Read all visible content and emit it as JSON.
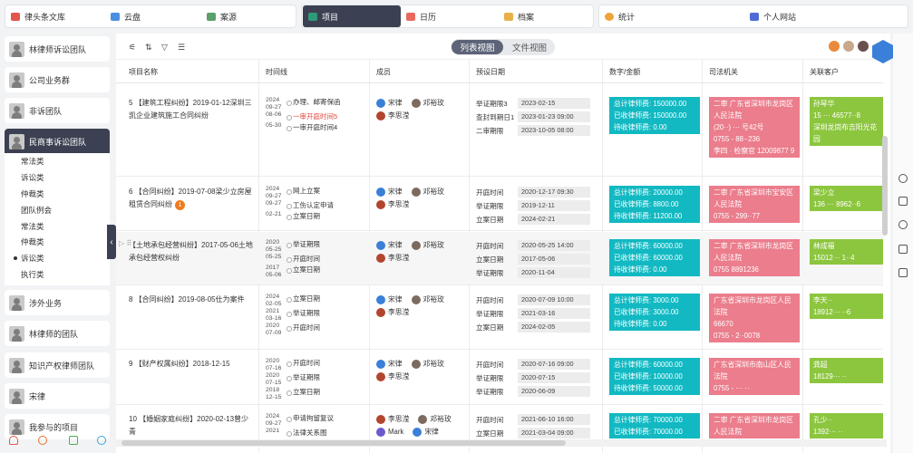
{
  "topnav": {
    "items": [
      {
        "label": "律头条文库",
        "color": "#e4554f"
      },
      {
        "label": "云盘",
        "color": "#4a90e2"
      },
      {
        "label": "案源",
        "color": "#5aa06a"
      },
      {
        "label": "项目",
        "color": "#2f9a7a"
      },
      {
        "label": "日历",
        "color": "#e86a5f"
      },
      {
        "label": "档案",
        "color": "#e8b04a"
      },
      {
        "label": "统计",
        "color": "#f0a33a"
      },
      {
        "label": "个人网站",
        "color": "#4c6bd6"
      }
    ]
  },
  "sidebar": {
    "teams": [
      "林律师诉讼团队",
      "公司业务群",
      "非诉团队",
      "民商事诉讼团队",
      "涉外业务",
      "林律师的团队",
      "知识产权律师团队",
      "宋律",
      "我参与的项目"
    ],
    "subitems": [
      "常法类",
      "诉讼类",
      "仲裁类",
      "团队例会",
      "常法类",
      "仲裁类",
      "诉讼类",
      "执行类"
    ],
    "collapse_icon": "‹"
  },
  "toolbar": {
    "view_list": "列表视图",
    "view_doc": "文件视图"
  },
  "columns": {
    "name": "项目名称",
    "timeline": "时间线",
    "members": "成员",
    "dates": "预设日期",
    "fees": "数字/金额",
    "court": "司法机关",
    "client": "关联客户"
  },
  "rows": [
    {
      "name": "5  【建筑工程纠纷】2019-01-12深圳三凯企业建筑施工合同纠纷",
      "badge": "",
      "timeline": [
        {
          "d": "2024\n09-27",
          "t": "办理、邮寄保函"
        },
        {
          "d": "08-06",
          "t": "一审开庭时间5",
          "red": true
        },
        {
          "d": "05-30",
          "t": "一审开庭时间4"
        }
      ],
      "members": [
        [
          "宋律",
          "邓裕玫"
        ],
        [
          "李思滢"
        ]
      ],
      "dates": [
        [
          "举证期限3",
          "2023-02-15"
        ],
        [
          "查封到期日1",
          "2023-01-23 09:00"
        ],
        [
          "二审期限",
          "2023-10-05 08:00"
        ]
      ],
      "fees": [
        "总计律师费: 150000.00",
        "已收律师费: 150000.00",
        "待收律师费: 0.00"
      ],
      "court": "二审 广东省深圳市龙岗区人民法院\n(20··) ··· 号42号\n0755 - 88··236\n李四 · 检察官 12009877 9",
      "client": "孙琴华\n15 ··· 46577··8\n深圳龙岗布吉阳光花园"
    },
    {
      "name": "6  【合同纠纷】2019-07-08梁少立房屋租赁合同纠纷",
      "badge": "1",
      "timeline": [
        {
          "d": "2024\n09-27",
          "t": "网上立案"
        },
        {
          "d": "09-27",
          "t": "工伤认定申请"
        },
        {
          "d": "02-21",
          "t": "立案日期"
        }
      ],
      "members": [
        [
          "宋律",
          "邓裕玫"
        ],
        [
          "李思滢"
        ]
      ],
      "dates": [
        [
          "开庭时间",
          "2020-12-17 09:30"
        ],
        [
          "举证期限",
          "2019-12-11"
        ],
        [
          "立案日期",
          "2024-02-21"
        ]
      ],
      "fees": [
        "总计律师费: 20000.00",
        "已收律师费: 8800.00",
        "待收律师费: 11200.00"
      ],
      "court": "二审 广东省深圳市宝安区人民法院\n0755 - 299··77",
      "client": "梁少立\n136 ··· 8962··6"
    },
    {
      "name": "【土地承包经营纠纷】2017-05-06土地承包经营权纠纷",
      "badge": "",
      "timeline": [
        {
          "d": "2020\n05-25",
          "t": "举证期限"
        },
        {
          "d": "05-25",
          "t": "开庭时间"
        },
        {
          "d": "2017\n05-06",
          "t": "立案日期"
        }
      ],
      "members": [
        [
          "宋律",
          "邓裕玫"
        ],
        [
          "李思滢"
        ]
      ],
      "dates": [
        [
          "开庭时间",
          "2020-05-25 14:00"
        ],
        [
          "立案日期",
          "2017-05-06"
        ],
        [
          "举证期限",
          "2020-11-04"
        ]
      ],
      "fees": [
        "总计律师费: 60000.00",
        "已收律师费: 60000.00",
        "待收律师费: 0.00"
      ],
      "court": "二审 广东省深圳市龙岗区人民法院\n0755 8891236",
      "client": "林成福\n15012··· 1··4"
    },
    {
      "name": "8  【合同纠纷】2019-08-05仕为案件",
      "badge": "",
      "timeline": [
        {
          "d": "2024\n02-05",
          "t": "立案日期"
        },
        {
          "d": "2021\n03-16",
          "t": "举证期限"
        },
        {
          "d": "2020\n07-09",
          "t": "开庭时间"
        }
      ],
      "members": [
        [
          "宋律",
          "邓裕玫"
        ],
        [
          "李思滢"
        ]
      ],
      "dates": [
        [
          "开庭时间",
          "2020-07-09 10:00"
        ],
        [
          "举证期限",
          "2021-03-16"
        ],
        [
          "立案日期",
          "2024-02-05"
        ]
      ],
      "fees": [
        "总计律师费: 3000.00",
        "已收律师费: 3000.00",
        "待收律师费: 0.00"
      ],
      "court": "广东省深圳市龙岗区人民法院\n66670\n0755 - 2··0078",
      "client": "李天··\n18912··· ··6"
    },
    {
      "name": "9  【财产权属纠纷】2018-12-15",
      "badge": "",
      "timeline": [
        {
          "d": "2020\n07-16",
          "t": "开庭时间"
        },
        {
          "d": "2020\n07-15",
          "t": "举证期限"
        },
        {
          "d": "2018\n12-15",
          "t": "立案日期"
        }
      ],
      "members": [
        [
          "宋律",
          "邓裕玫"
        ],
        [
          "李思滢"
        ]
      ],
      "dates": [
        [
          "开庭时间",
          "2020-07-16 09:00"
        ],
        [
          "举证期限",
          "2020-07-15"
        ],
        [
          "举证期限",
          "2020-06-09"
        ]
      ],
      "fees": [
        "总计律师费: 60000.00",
        "已收律师费: 10000.00",
        "待收律师费: 50000.00"
      ],
      "court": "广东省深圳市南山区人民法院\n0755 - ··· ··",
      "client": "龚超\n18129··· ··"
    },
    {
      "name": "10  【婚姻家庭纠纷】2020-02-13曾少青",
      "badge": "",
      "timeline": [
        {
          "d": "2024\n09-27",
          "t": "申请拘留复议"
        },
        {
          "d": "2021",
          "t": "法律关系图"
        }
      ],
      "members": [
        [
          "李思滢",
          "邓裕玫"
        ],
        [
          "Mark",
          "宋律"
        ]
      ],
      "dates": [
        [
          "开庭时间",
          "2021-06-10 16:00"
        ],
        [
          "立案日期",
          "2021-03-04 09:00"
        ]
      ],
      "fees": [
        "总计律师费: 70000.00",
        "已收律师费: 70000.00"
      ],
      "court": "二审 广东省深圳市龙岗区人民法院",
      "client": "孔少··\n1392··· ··"
    }
  ],
  "colors": {
    "fee": "#12b9c2",
    "court": "#eb7d8c",
    "client": "#8cc63e",
    "dark": "#3b4152"
  }
}
